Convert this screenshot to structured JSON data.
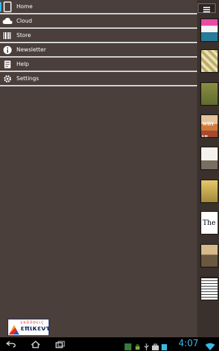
{
  "menu": {
    "items": [
      {
        "label": "Home",
        "icon": "tablet-icon"
      },
      {
        "label": "Cloud",
        "icon": "cloud-icon"
      },
      {
        "label": "Store",
        "icon": "barcode-icon"
      },
      {
        "label": "Newsletter",
        "icon": "info-icon"
      },
      {
        "label": "Help",
        "icon": "document-icon"
      },
      {
        "label": "Settings",
        "icon": "gear-icon"
      }
    ]
  },
  "logo": {
    "top_text": "εκδόσεις",
    "main_text": "επικεντρο"
  },
  "books": [
    {
      "text": ""
    },
    {
      "text": ""
    },
    {
      "text": ""
    },
    {
      "text": "WHY AB TEACH"
    },
    {
      "text": ""
    },
    {
      "text": ""
    },
    {
      "text": "The"
    },
    {
      "text": ""
    },
    {
      "text": ""
    }
  ],
  "status": {
    "time": "4:07"
  },
  "colors": {
    "accent": "#39b7e6",
    "background": "#3a302c"
  }
}
